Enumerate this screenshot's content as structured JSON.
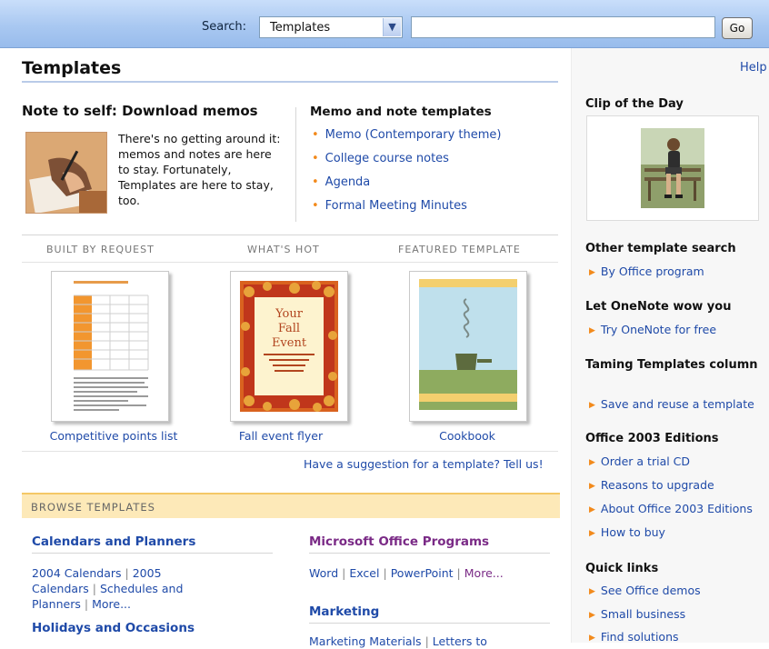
{
  "search": {
    "label": "Search:",
    "scope": "Templates",
    "query": "",
    "go_label": "Go"
  },
  "page": {
    "title": "Templates",
    "help_label": "Help"
  },
  "feature": {
    "heading": "Note to self: Download memos",
    "text": "There's no getting around it: memos and notes are here to stay. Fortunately, Templates are here to stay, too."
  },
  "memo": {
    "heading": "Memo and note templates",
    "items": [
      "Memo (Contemporary theme)",
      "College course notes",
      "Agenda",
      "Formal Meeting Minutes"
    ]
  },
  "showcase": {
    "columns": [
      {
        "label": "BUILT BY REQUEST",
        "caption": "Competitive points list"
      },
      {
        "label": "WHAT'S HOT",
        "caption": "Fall event flyer"
      },
      {
        "label": "FEATURED TEMPLATE",
        "caption": "Cookbook"
      }
    ],
    "flyer_lines": [
      "Your",
      "Fall",
      "Event"
    ],
    "suggest_link": "Have a suggestion for a template? Tell us!"
  },
  "browse": {
    "label": "BROWSE TEMPLATES",
    "calendars": {
      "heading": "Calendars and Planners",
      "links": [
        "2004 Calendars",
        "2005 Calendars",
        "Schedules and Planners",
        "More..."
      ]
    },
    "holidays": {
      "heading": "Holidays and Occasions"
    },
    "office_programs": {
      "heading": "Microsoft Office Programs",
      "links": [
        "Word",
        "Excel",
        "PowerPoint",
        "More..."
      ]
    },
    "marketing": {
      "heading": "Marketing",
      "links": [
        "Marketing Materials",
        "Letters to"
      ]
    }
  },
  "sidebar": {
    "clip_heading": "Clip of the Day",
    "other_search": {
      "heading": "Other template search",
      "links": [
        "By Office program"
      ]
    },
    "onenote": {
      "heading": "Let OneNote wow you",
      "links": [
        "Try OneNote for free"
      ]
    },
    "taming": {
      "heading": "Taming Templates column",
      "links": [
        "Save and reuse a template"
      ]
    },
    "editions": {
      "heading": "Office 2003 Editions",
      "links": [
        "Order a trial CD",
        "Reasons to upgrade",
        "About Office 2003 Editions",
        "How to buy"
      ]
    },
    "quick": {
      "heading": "Quick links",
      "links": [
        "See Office demos",
        "Small business",
        "Find solutions"
      ]
    }
  },
  "colors": {
    "link": "#1f4aa8",
    "bullet": "#f28a1c",
    "purple_heading": "#7a2a86",
    "blue_heading": "#1f4aa8",
    "browse_bar": "#fde9b8"
  }
}
